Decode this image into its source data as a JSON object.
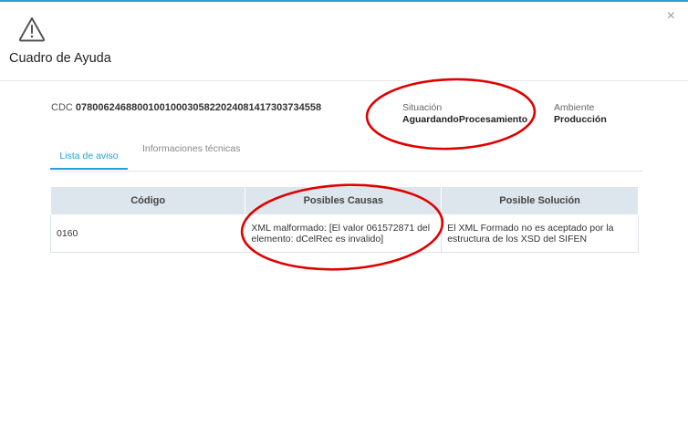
{
  "dialog": {
    "title": "Cuadro de Ayuda",
    "close_glyph": "×",
    "icon": "warning-triangle-icon"
  },
  "header": {
    "cdc_label": "CDC",
    "cdc_value": "07800624688001001000305822024081417303734558",
    "situacion_label": "Situación",
    "situacion_value": "AguardandoProcesamiento",
    "ambiente_label": "Ambiente",
    "ambiente_value": "Producción"
  },
  "tabs": [
    {
      "label": "Lista de aviso",
      "active": true
    },
    {
      "label": "Informaciones técnicas",
      "active": false
    }
  ],
  "table": {
    "columns": [
      "Código",
      "Posibles Causas",
      "Posible Solución"
    ],
    "rows": [
      {
        "codigo": "0160",
        "causa": "XML malformado: [El valor 061572871 del elemento: dCelRec es invalido]",
        "solucion": "El XML Formado no es aceptado por la estructura de los XSD del SIFEN"
      }
    ]
  },
  "colors": {
    "accent": "#2a9fd6",
    "header_bg": "#dde6ec",
    "annotation": "#e00000"
  }
}
